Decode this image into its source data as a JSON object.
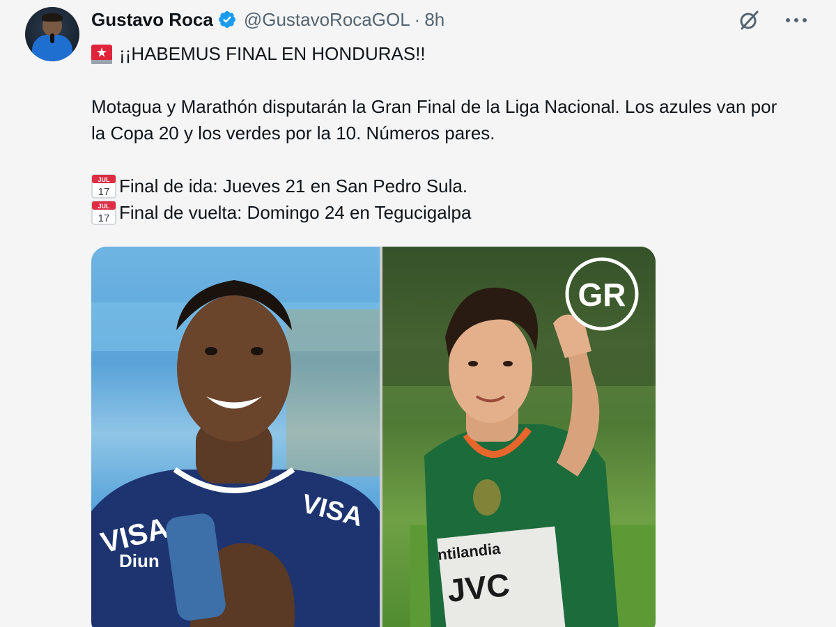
{
  "author": {
    "name": "Gustavo Roca",
    "handle": "@GustavoRocaGOL",
    "separator": "·",
    "time": "8h"
  },
  "icons": {
    "verified": "verified-badge-icon",
    "grok": "grok-icon",
    "more": "more-icon",
    "siren": "siren-icon",
    "calendar": "calendar-icon"
  },
  "tweet": {
    "headline": "¡¡HABEMUS FINAL EN HONDURAS!!",
    "paragraph": "Motagua y Marathón disputarán la Gran Final de la Liga Nacional. Los azules van por la Copa 20 y los verdes por la 10. Números pares.",
    "schedule": [
      "Final de ida: Jueves 21 en San Pedro Sula.",
      "Final de vuelta: Domingo 24 en Tegucigalpa"
    ],
    "calendar_emoji": {
      "month": "JUL",
      "day": "17"
    }
  },
  "media": {
    "watermark": "GR"
  },
  "colors": {
    "verified": "#1d9bf0",
    "text": "#0f1419",
    "muted": "#536471",
    "background": "#f5f5f5"
  }
}
